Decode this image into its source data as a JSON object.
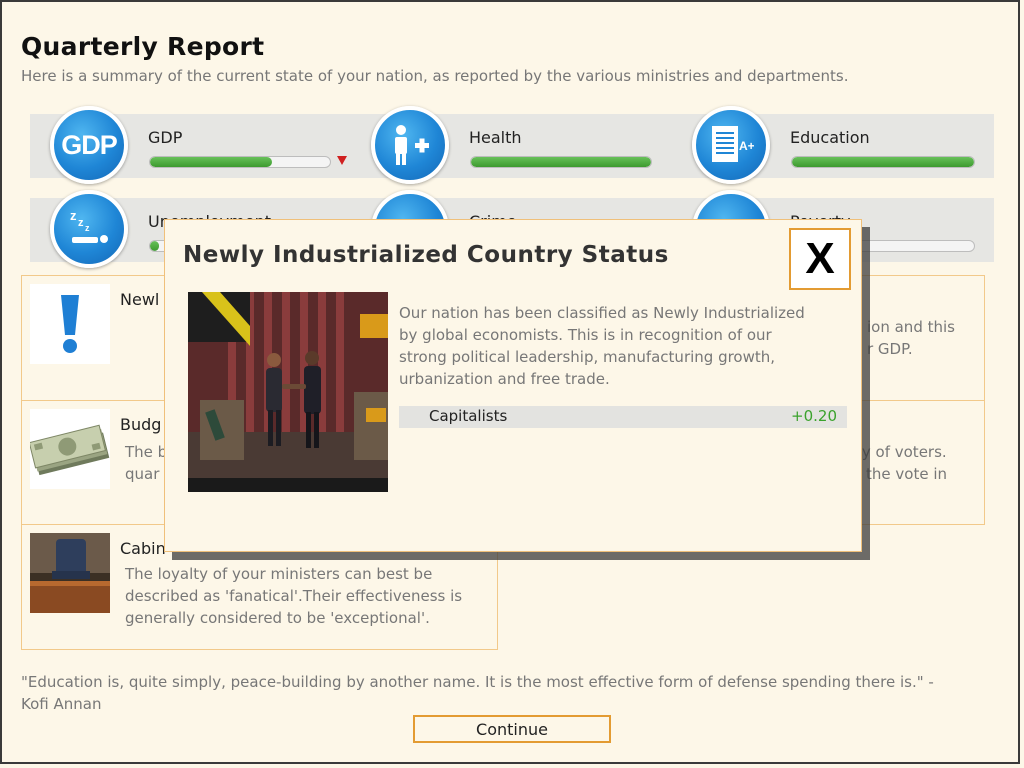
{
  "header": {
    "title": "Quarterly Report",
    "subtitle": "Here is a summary of the current state of your nation, as reported by the various ministries and departments."
  },
  "stats_row1": [
    {
      "label": "GDP",
      "icon": "gdp-icon",
      "icon_text": "GDP",
      "progress": 0.68,
      "trend": "down"
    },
    {
      "label": "Health",
      "icon": "health-icon",
      "progress": 1.0
    },
    {
      "label": "Education",
      "icon": "education-icon",
      "progress": 1.0
    }
  ],
  "stats_row2": [
    {
      "label": "Unemployment",
      "icon": "unemployment-icon",
      "progress": 0.05
    },
    {
      "label": "Crime",
      "icon": "crime-icon"
    },
    {
      "label": "Poverty",
      "icon": "poverty-icon",
      "progress": 0.0
    }
  ],
  "cards": {
    "news": {
      "title": "Newl",
      "text_line1": "ion and this",
      "text_line2": "r GDP."
    },
    "budget": {
      "title": "Budg",
      "left_line1": "The b",
      "left_line2": "quar",
      "right_line1": "ty of voters.",
      "right_line2": "f the vote in"
    },
    "cabinet": {
      "title": "Cabin",
      "text_line1": "The loyalty of your ministers can best be",
      "text_line2": "described as 'fanatical'.Their effectiveness is",
      "text_line3": "generally considered to be 'exceptional'."
    }
  },
  "quote": {
    "line1": "\"Education is, quite simply, peace-building by another name. It is the most effective form of defense spending there is.\" -",
    "line2": "Kofi Annan"
  },
  "continue_label": "Continue",
  "modal": {
    "title": "Newly Industrialized Country Status",
    "close_label": "X",
    "text_line1": "Our nation has been classified as Newly Industrialized",
    "text_line2": "by global economists. This is in recognition of our",
    "text_line3": "strong political leadership, manufacturing growth,",
    "text_line4": "urbanization and free trade.",
    "effect": {
      "name": "Capitalists",
      "value": "+0.20"
    }
  },
  "colors": {
    "background": "#fdf7e8",
    "accent_border": "#e39b32",
    "bar_green": "#4caf3a",
    "positive": "#3aa22c",
    "icon_blue": "#1f86d6",
    "alert_blue": "#1f7fd4"
  }
}
